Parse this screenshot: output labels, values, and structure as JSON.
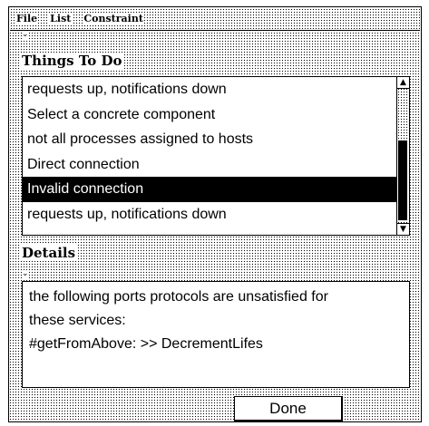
{
  "menubar": {
    "items": [
      {
        "label": "File"
      },
      {
        "label": "List"
      },
      {
        "label": "Constraint"
      }
    ]
  },
  "todo": {
    "title": "Things To Do",
    "items": [
      {
        "label": "requests up, notifications down",
        "selected": false
      },
      {
        "label": "Select a concrete component",
        "selected": false
      },
      {
        "label": "not all processes assigned to hosts",
        "selected": false
      },
      {
        "label": "Direct connection",
        "selected": false
      },
      {
        "label": "Invalid connection",
        "selected": true
      },
      {
        "label": "requests up, notifications down",
        "selected": false
      }
    ],
    "scroll_position": 0.55
  },
  "details": {
    "title": "Details",
    "lines": [
      "the following ports protocols are unsatisfied for",
      "these services:",
      "#getFromAbove: >>  DecrementLifes"
    ]
  },
  "done_button": {
    "label": "Done"
  },
  "icons": {
    "scroll_up": "arrow-up-icon",
    "scroll_down": "arrow-down-icon",
    "section_caret": "caret-down-icon"
  }
}
